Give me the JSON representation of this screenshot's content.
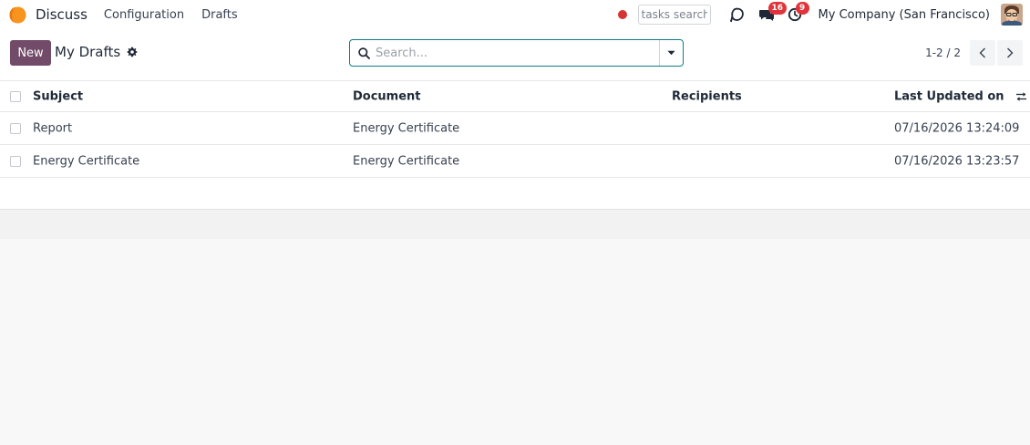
{
  "colors": {
    "brand": "#714b67",
    "logo": "#f7941d",
    "record_dot": "#d63333",
    "badge": "#e0343a",
    "search_border": "#0e7c86"
  },
  "navbar": {
    "app_name": "Discuss",
    "menu": [
      "Configuration",
      "Drafts"
    ],
    "tasks_search_placeholder": "tasks search",
    "messages_badge": "16",
    "activities_badge": "9",
    "company": "My Company (San Francisco)",
    "icons": [
      "odoo-logo-icon",
      "record-dot-icon",
      "voip-icon",
      "chat-icon",
      "clock-icon",
      "avatar"
    ]
  },
  "control_panel": {
    "new_label": "New",
    "title": "My Drafts",
    "search_placeholder": "Search...",
    "pager": "1-2 / 2"
  },
  "list": {
    "columns": [
      "Subject",
      "Document",
      "Recipients",
      "Last Updated on"
    ],
    "rows": [
      {
        "subject": "Report",
        "document": "Energy Certificate",
        "recipients": "",
        "updated": "07/16/2026 13:24:09"
      },
      {
        "subject": "Energy Certificate",
        "document": "Energy Certificate",
        "recipients": "",
        "updated": "07/16/2026 13:23:57"
      }
    ]
  }
}
